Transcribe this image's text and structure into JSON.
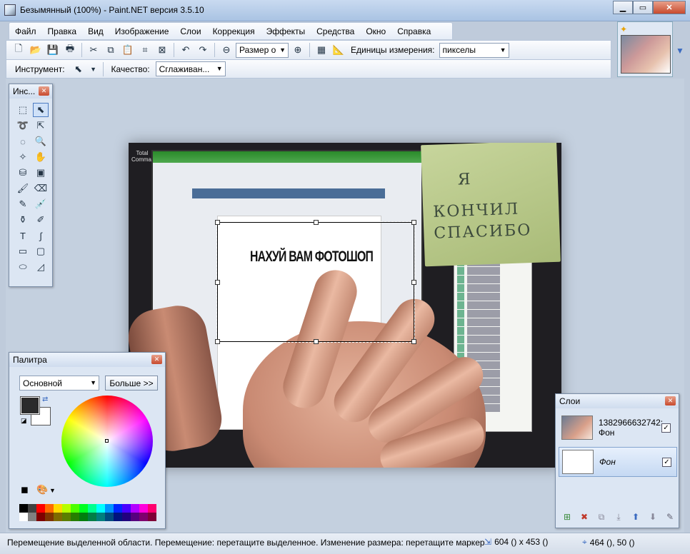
{
  "window": {
    "title": "Безымянный (100%) - Paint.NET версия 3.5.10",
    "minimize": "▁",
    "maximize": "▭",
    "close": "✕"
  },
  "menu": [
    "Файл",
    "Правка",
    "Вид",
    "Изображение",
    "Слои",
    "Коррекция",
    "Эффекты",
    "Средства",
    "Окно",
    "Справка"
  ],
  "toolbar": {
    "zoom_value": "Размер о",
    "units_label": "Единицы измерения:",
    "units_value": "пикселы",
    "tool_label": "Инструмент:",
    "quality_label": "Качество:",
    "quality_value": "Сглаживан..."
  },
  "tools_panel": {
    "title": "Инс...",
    "icons": [
      "rectangle-select-icon",
      "move-selection-icon",
      "lasso-icon",
      "move-selected-icon",
      "ellipse-select-icon",
      "zoom-icon",
      "magic-wand-icon",
      "pan-icon",
      "paint-bucket-icon",
      "gradient-icon",
      "paintbrush-icon",
      "eraser-icon",
      "pencil-icon",
      "color-picker-icon",
      "clone-stamp-icon",
      "recolor-icon",
      "text-icon",
      "line-curve-icon",
      "rectangle-icon",
      "rounded-rectangle-icon",
      "ellipse-icon",
      "freeform-shape-icon"
    ]
  },
  "palette_panel": {
    "title": "Палитра",
    "mode_value": "Основной",
    "more_label": "Больше >>",
    "primary_color": "#2b2b2b",
    "secondary_color": "#ffffff",
    "swatch_colors": [
      "#000000",
      "#404040",
      "#ff0000",
      "#ff6a00",
      "#ffd800",
      "#b6ff00",
      "#4cff00",
      "#00ff21",
      "#00ff90",
      "#00ffff",
      "#0094ff",
      "#0026ff",
      "#4800ff",
      "#b200ff",
      "#ff00dc",
      "#ff006e",
      "#ffffff",
      "#808080",
      "#7f0000",
      "#7f3300",
      "#7f6a00",
      "#5b7f00",
      "#267f00",
      "#007f0e",
      "#007f46",
      "#007f7f",
      "#004a7f",
      "#00137f",
      "#21007f",
      "#57007f",
      "#7f006e",
      "#7f0037"
    ]
  },
  "image": {
    "label_total": "Total Commander",
    "vk_text": "НАХУЙ ВАМ ФОТОШОП",
    "sticky_lines": [
      "Я",
      "КОНЧИЛ",
      "СПАСИБО"
    ]
  },
  "layers_panel": {
    "title": "Слои",
    "layers": [
      {
        "name": "1382966632742: Фон",
        "visible": true
      },
      {
        "name": "Фон",
        "visible": true
      }
    ]
  },
  "status": {
    "message": "Перемещение выделенной области. Перемещение: перетащите выделенное. Изменение размера: перетащите маркер",
    "selection_size": "604 () x 453 ()",
    "cursor_position": "464 (), 50 ()"
  }
}
